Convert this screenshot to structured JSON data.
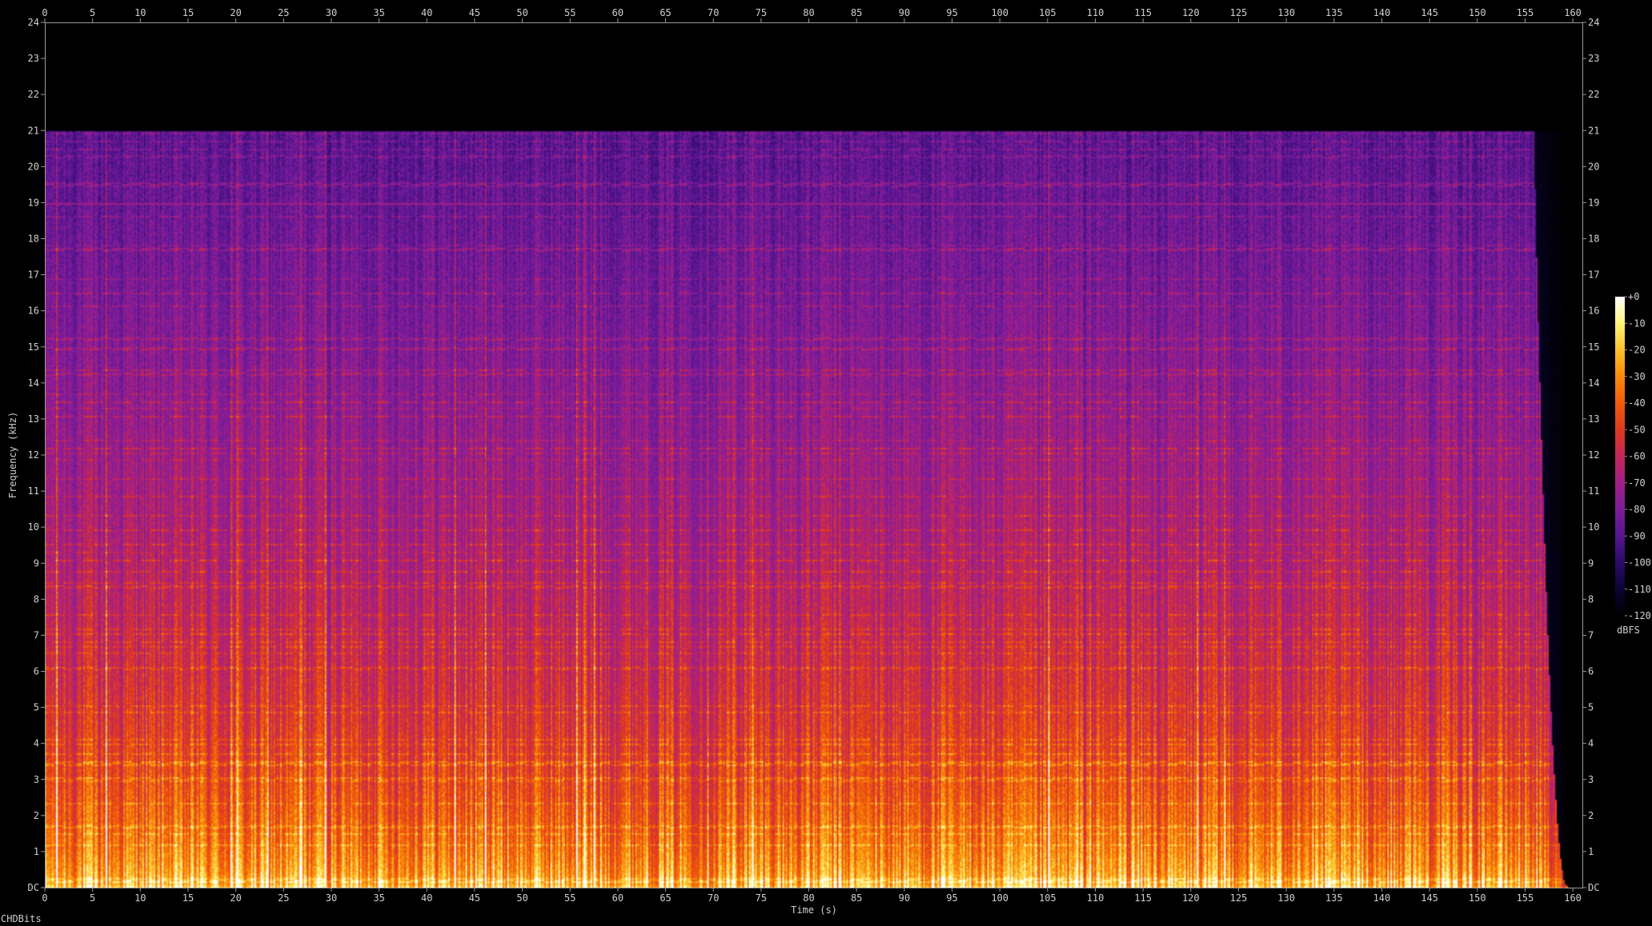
{
  "chart_data": {
    "type": "heatmap",
    "title": "",
    "xlabel": "Time (s)",
    "ylabel": "Frequency (kHz)",
    "xlim": [
      0,
      161
    ],
    "ylim": [
      0,
      24
    ],
    "x_ticks": [
      "0",
      "5",
      "10",
      "15",
      "20",
      "25",
      "30",
      "35",
      "40",
      "45",
      "50",
      "55",
      "60",
      "65",
      "70",
      "75",
      "80",
      "85",
      "90",
      "95",
      "100",
      "105",
      "110",
      "115",
      "120",
      "125",
      "130",
      "135",
      "140",
      "145",
      "150",
      "155",
      "160"
    ],
    "y_ticks": [
      "DC",
      "1",
      "2",
      "3",
      "4",
      "5",
      "6",
      "7",
      "8",
      "9",
      "10",
      "11",
      "12",
      "13",
      "14",
      "15",
      "16",
      "17",
      "18",
      "19",
      "20",
      "21",
      "22",
      "23",
      "24"
    ],
    "audio_end_seconds": 156,
    "lowpass_cutoff_khz": 21,
    "tone_line_khz": 19,
    "colorbar": {
      "label": "dBFS",
      "ticks": [
        "+0",
        "-10",
        "-20",
        "-30",
        "-40",
        "-50",
        "-60",
        "-70",
        "-80",
        "-90",
        "-100",
        "-110",
        "-120"
      ],
      "range": [
        -120,
        0
      ],
      "colors": [
        "#000000",
        "#0a0435",
        "#2a0a6a",
        "#56158f",
        "#7d1c9a",
        "#a01f86",
        "#c3265a",
        "#de3a1f",
        "#f05a0c",
        "#f98a09",
        "#fcc02b",
        "#fff37a",
        "#ffffff"
      ]
    },
    "footer": "CHDBits"
  }
}
